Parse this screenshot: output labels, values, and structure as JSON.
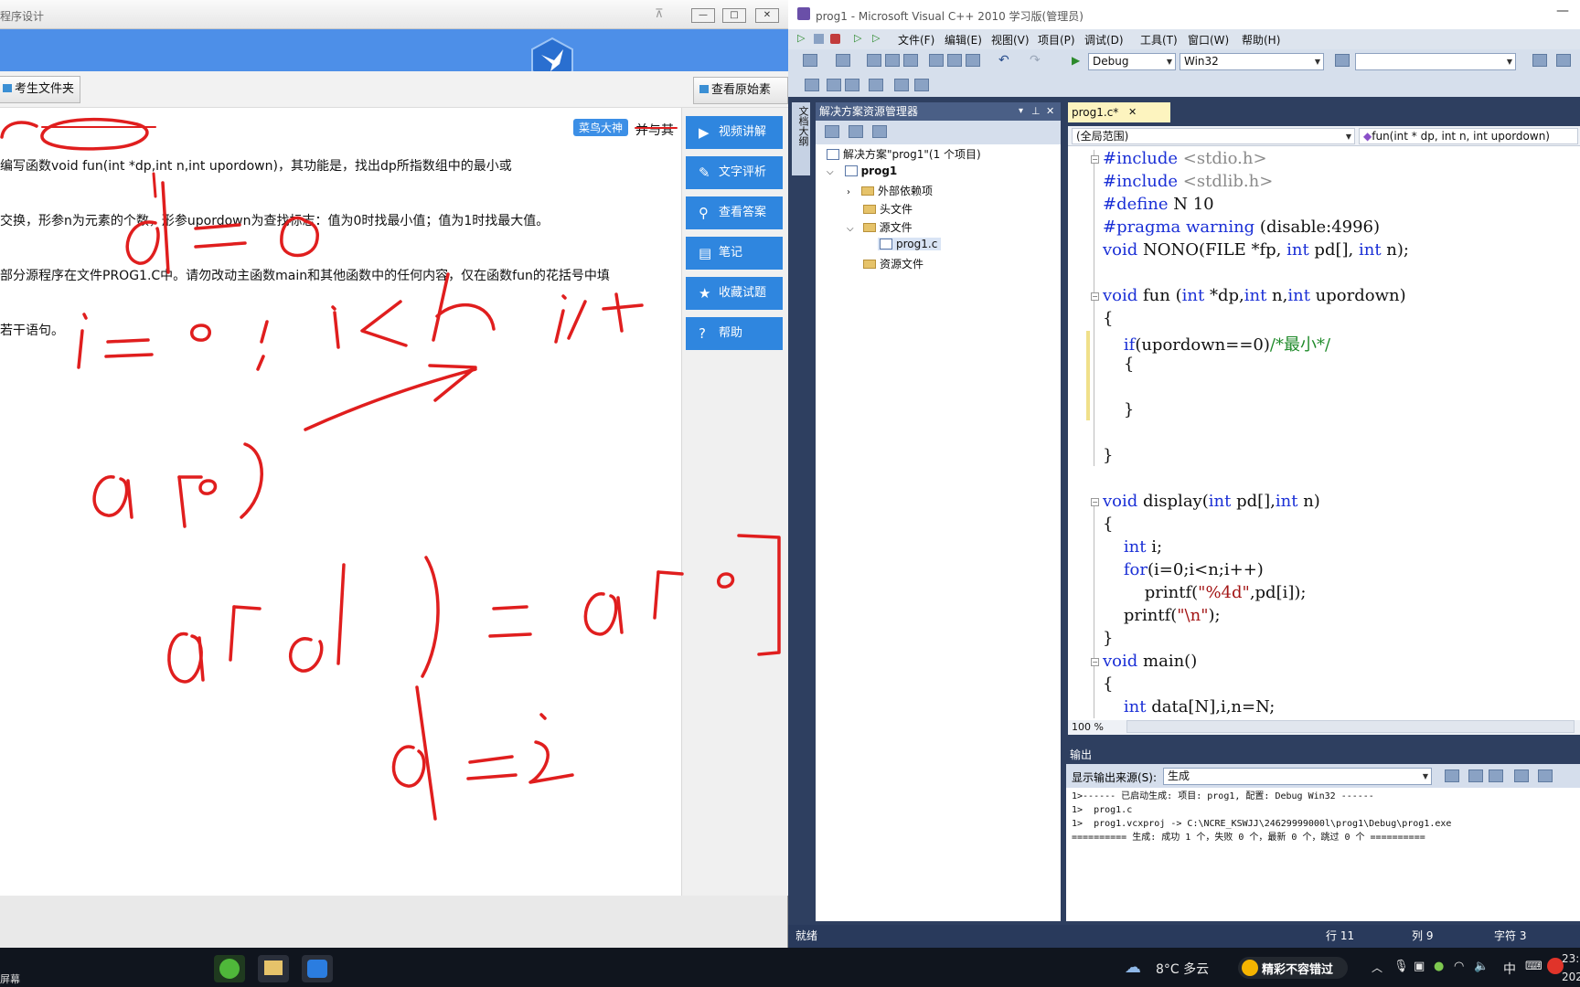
{
  "exam": {
    "title": "程序设计",
    "win_buttons": [
      "—",
      "□",
      "✕"
    ],
    "folder_button": "考生文件夹",
    "source_button": "查看原始素材",
    "question_lines": [
      "编写函数void fun(int *dp,int n,int upordown)，其功能是，找出dp所指数组中的最小或",
      "交换，形参n为元素的个数，形参upordown为查找标志：值为0时找最小值；值为1时找最大值。",
      "部分源程序在文件PROG1.C中。请勿改动主函数main和其他函数中的任何内容，仅在函数fun的花括号中填",
      "若干语句。"
    ],
    "badge": "菜鸟大神",
    "badge_suffix": "并与其",
    "side_buttons": [
      {
        "label": "视频讲解",
        "icon": "video-icon"
      },
      {
        "label": "文字评析",
        "icon": "text-analysis-icon"
      },
      {
        "label": "查看答案",
        "icon": "search-icon"
      },
      {
        "label": "笔记",
        "icon": "note-icon"
      },
      {
        "label": "收藏试题",
        "icon": "star-icon"
      },
      {
        "label": "帮助",
        "icon": "help-icon"
      }
    ]
  },
  "vs": {
    "title": "prog1 - Microsoft Visual C++ 2010 学习版(管理员)",
    "menu": [
      "文件(F)",
      "编辑(E)",
      "视图(V)",
      "项目(P)",
      "调试(D)",
      "工具(T)",
      "窗口(W)",
      "帮助(H)"
    ],
    "config": "Debug",
    "platform": "Win32",
    "side_tab": "文档大纲",
    "solution_explorer": {
      "title": "解决方案资源管理器",
      "items": [
        {
          "label": "解决方案\"prog1\"(1 个项目)",
          "level": 0
        },
        {
          "label": "prog1",
          "level": 1
        },
        {
          "label": "外部依赖项",
          "level": 2
        },
        {
          "label": "头文件",
          "level": 2
        },
        {
          "label": "源文件",
          "level": 2
        },
        {
          "label": "prog1.c",
          "level": 3
        },
        {
          "label": "资源文件",
          "level": 2
        }
      ]
    },
    "editor": {
      "tab": "prog1.c*",
      "scope": "(全局范围)",
      "function": "fun(int * dp, int n, int upordown)",
      "zoom": "100 %"
    },
    "output": {
      "title": "输出",
      "source_label": "显示输出来源(S):",
      "source_value": "生成",
      "lines": [
        "1>------ 已启动生成: 项目: prog1, 配置: Debug Win32 ------",
        "1>  prog1.c",
        "1>  prog1.vcxproj -> C:\\NCRE_KSWJJ\\24629999000l\\prog1\\Debug\\prog1.exe",
        "========== 生成: 成功 1 个，失败 0 个，最新 0 个，跳过 0 个 =========="
      ]
    },
    "status": {
      "ready": "就绪",
      "line": "行 11",
      "col": "列 9",
      "char": "字符 3"
    }
  },
  "taskbar": {
    "left_text": "屏幕",
    "weather": "8°C 多云",
    "news": "精彩不容错过",
    "ime": "中",
    "time": "23:3",
    "date": "202"
  },
  "colors": {
    "exam_blue": "#2f86df",
    "vs_keyword": "#1a2fd6",
    "ink": "#e01e1e"
  }
}
